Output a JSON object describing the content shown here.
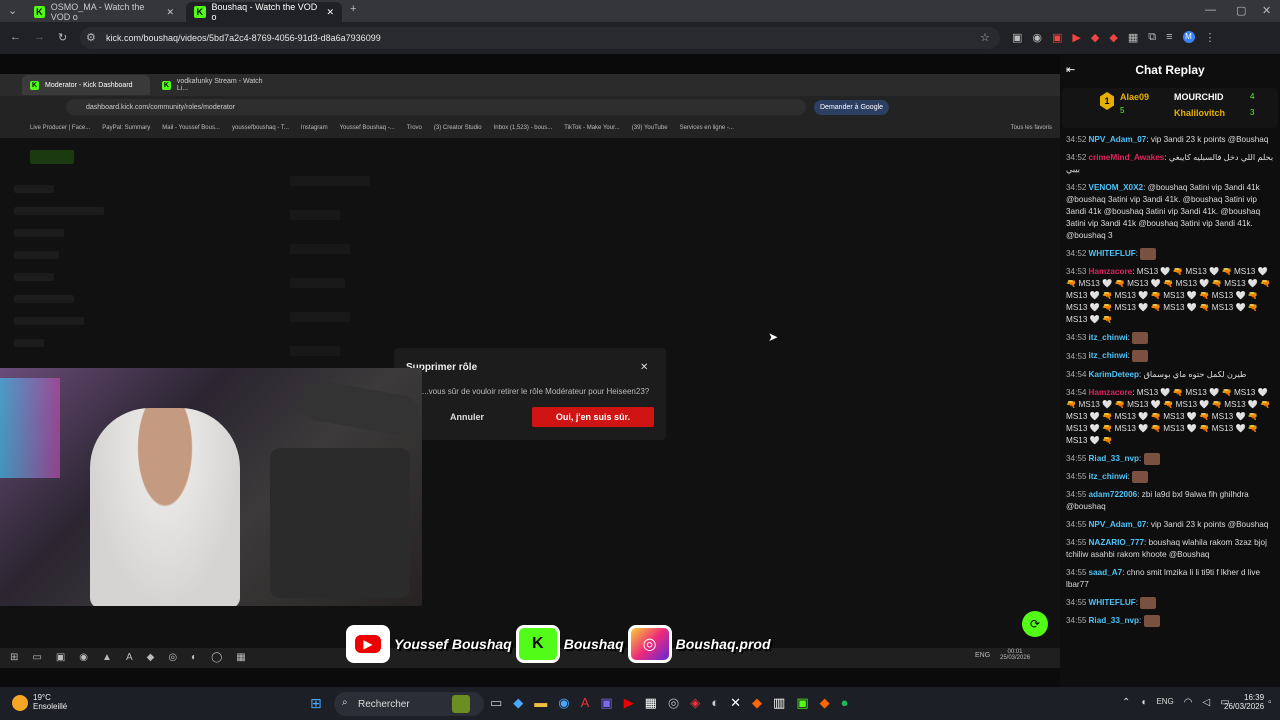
{
  "outer_browser": {
    "tabs": [
      {
        "label": "OSMO_MA - Watch the VOD o",
        "active": false
      },
      {
        "label": "Boushaq - Watch the VOD o",
        "active": true
      }
    ],
    "url": "kick.com/boushaq/videos/5bd7a2c4-8769-4056-91d3-d8a6a7936099"
  },
  "inner_browser": {
    "tabs": [
      {
        "label": "Moderator - Kick Dashboard",
        "active": true
      },
      {
        "label": "vodkafunky Stream - Watch Li...",
        "active": false
      }
    ],
    "url": "dashboard.kick.com/community/roles/moderator",
    "ask_google": "Demander à Google",
    "bookmarks": [
      "Live Producer | Face...",
      "PayPal: Summary",
      "Mail - Youssef Bous...",
      "youssefboushaq - T...",
      "Instagram",
      "Youssef Boushaq -...",
      "Trovo",
      "(3) Creator Studio",
      "Inbox (1,523) - bous...",
      "TikTok - Make Your...",
      "(39) YouTube",
      "Services en ligne -...",
      "Tous les favoris"
    ],
    "taskbar": {
      "lang": "ENG",
      "time": "00:01",
      "date": "25/03/2026"
    }
  },
  "dialog": {
    "title": "Supprimer rôle",
    "message": "...vous sûr de vouloir retirer le rôle Modérateur pour Heiseen23?",
    "cancel": "Annuler",
    "confirm": "Oui, j'en suis sûr."
  },
  "social": {
    "youtube": "Youssef Boushaq",
    "kick": "Boushaq",
    "instagram": "Boushaq.prod"
  },
  "chat": {
    "title": "Chat Replay",
    "leaders": [
      {
        "name": "Alae09",
        "count": "5",
        "rank": "1"
      },
      {
        "name": "MOURCHID",
        "count": "4"
      },
      {
        "name": "Khalilovitch",
        "count": "3"
      }
    ],
    "messages": [
      {
        "ts": "34:52",
        "user": "NPV_Adam_07",
        "color": "#4fc3f7",
        "text": "vip 3andi 23 k points @Boushaq"
      },
      {
        "ts": "34:52",
        "user": "crimeMind_Awakes",
        "color": "#e0245e",
        "text": "بحلم اللي دخل فالسبليه كايبغي بيبي"
      },
      {
        "ts": "34:52",
        "user": "VENOM_X0X2",
        "color": "#4fc3f7",
        "text": "@boushaq 3atini vip 3andi 41k @boushaq 3atini vip 3andi 41k. @boushaq 3atini vip 3andi 41k @boushaq 3atini vip 3andi 41k. @boushaq 3atini vip 3andi 41k @boushaq 3atini vip 3andi 41k. @boushaq 3"
      },
      {
        "ts": "34:52",
        "user": "WHITEFLUF",
        "color": "#4fc3f7",
        "text": "",
        "emote": true
      },
      {
        "ts": "34:53",
        "user": "Hamzacore",
        "color": "#e0245e",
        "text": "MS13 🤍 🔫 MS13 🤍 🔫 MS13 🤍 🔫 MS13 🤍 🔫 MS13 🤍 🔫 MS13 🤍 🔫 MS13 🤍 🔫 MS13 🤍 🔫 MS13 🤍 🔫 MS13 🤍 🔫 MS13 🤍 🔫 MS13 🤍 🔫 MS13 🤍 🔫 MS13 🤍 🔫 MS13 🤍 🔫 MS13 🤍 🔫"
      },
      {
        "ts": "34:53",
        "user": "itz_chinwi",
        "color": "#4fc3f7",
        "text": "",
        "emote": true
      },
      {
        "ts": "34:53",
        "user": "itz_chinwi",
        "color": "#4fc3f7",
        "text": "",
        "emote": true
      },
      {
        "ts": "34:54",
        "user": "KarimDeteep",
        "color": "#4fc3f7",
        "text": "طيرن لكمل حتوه ماي بوسماق"
      },
      {
        "ts": "34:54",
        "user": "Hamzacore",
        "color": "#e0245e",
        "text": "MS13 🤍 🔫 MS13 🤍 🔫 MS13 🤍 🔫 MS13 🤍 🔫 MS13 🤍 🔫 MS13 🤍 🔫 MS13 🤍 🔫 MS13 🤍 🔫 MS13 🤍 🔫 MS13 🤍 🔫 MS13 🤍 🔫 MS13 🤍 🔫 MS13 🤍 🔫 MS13 🤍 🔫 MS13 🤍 🔫 MS13 🤍 🔫"
      },
      {
        "ts": "34:55",
        "user": "Riad_33_nvp",
        "color": "#4fc3f7",
        "text": "",
        "emote": true
      },
      {
        "ts": "34:55",
        "user": "itz_chinwi",
        "color": "#4fc3f7",
        "text": "",
        "emote": true
      },
      {
        "ts": "34:55",
        "user": "adam722006",
        "color": "#4fc3f7",
        "text": "zbi la9d bxl 9alwa fih ghilhdra @boushaq"
      },
      {
        "ts": "34:55",
        "user": "NPV_Adam_07",
        "color": "#4fc3f7",
        "text": "vip 3andi 23 k points @Boushaq"
      },
      {
        "ts": "34:55",
        "user": "NAZARIO_777",
        "color": "#4fc3f7",
        "text": "boushaq wlahila rakom 3zaz bjoj tchiliw asahbi rakom khoote @Boushaq"
      },
      {
        "ts": "34:55",
        "user": "saad_A7",
        "color": "#4fc3f7",
        "text": "chno smit lmzika li li ti9ti f lkher d live lbar77"
      },
      {
        "ts": "34:55",
        "user": "WHITEFLUF",
        "color": "#4fc3f7",
        "text": "",
        "emote": true
      },
      {
        "ts": "34:55",
        "user": "Riad_33_nvp",
        "color": "#4fc3f7",
        "text": "",
        "emote": true
      }
    ]
  },
  "taskbar": {
    "weather_temp": "19°C",
    "weather_desc": "Ensoleillé",
    "search_placeholder": "Rechercher",
    "lang": "ENG",
    "time": "16:39",
    "date": "26/03/2026"
  }
}
